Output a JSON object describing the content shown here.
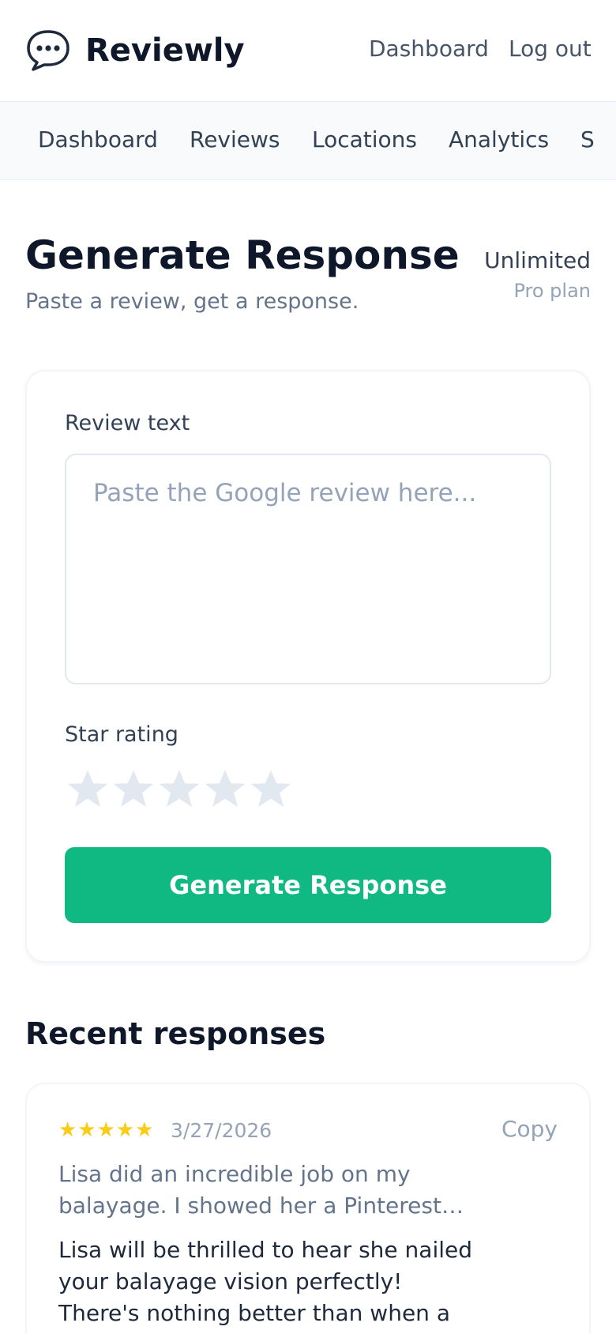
{
  "app": {
    "name": "Reviewly",
    "logo_icon": "speech-bubble-icon"
  },
  "header": {
    "links": [
      "Dashboard",
      "Log out"
    ]
  },
  "nav": {
    "items": [
      "Dashboard",
      "Reviews",
      "Locations",
      "Analytics",
      "S"
    ]
  },
  "page": {
    "title": "Generate Response",
    "subtitle": "Paste a review, get a response."
  },
  "plan": {
    "label": "Unlimited",
    "name": "Pro plan"
  },
  "form": {
    "review_label": "Review text",
    "review_placeholder": "Paste the Google review here...",
    "review_value": "",
    "rating_label": "Star rating",
    "rating_value": 0,
    "rating_max": 5,
    "submit_label": "Generate Response"
  },
  "recent": {
    "title": "Recent responses",
    "items": [
      {
        "stars": "★★★★★",
        "date": "3/27/2026",
        "copy_label": "Copy",
        "review_line1": "Lisa did an incredible job on my",
        "review_line2": "balayage. I showed her a Pinterest…",
        "reply_line1": "Lisa will be thrilled to hear she nailed",
        "reply_line2": "your balayage vision perfectly!",
        "reply_line3": "There's nothing better than when a"
      }
    ]
  },
  "colors": {
    "accent": "#10b981",
    "star_filled": "#facc15",
    "star_empty": "#e2e8f0",
    "text_primary": "#0f172a",
    "text_muted": "#64748b"
  }
}
